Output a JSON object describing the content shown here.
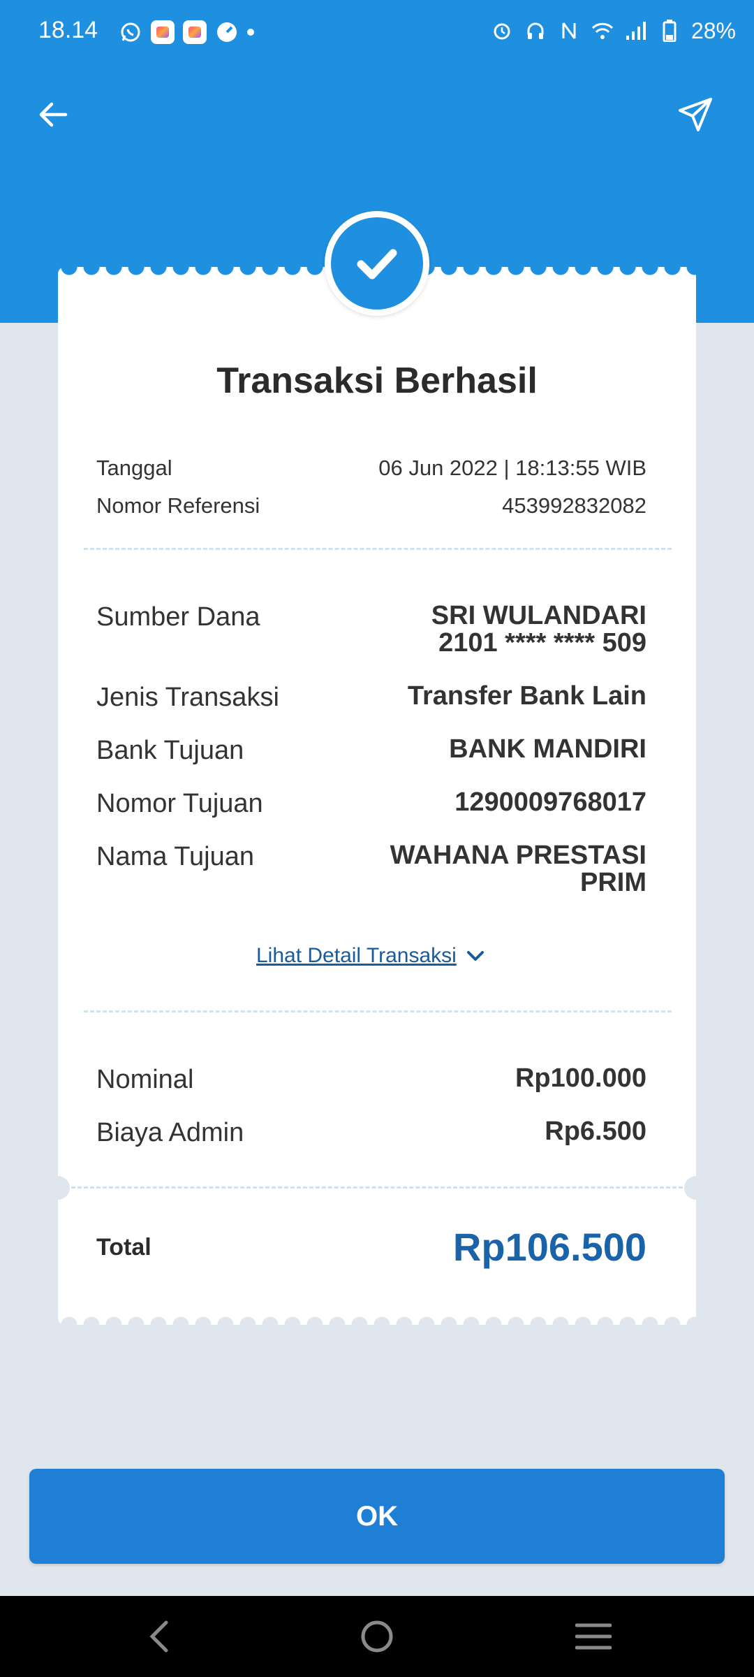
{
  "status_bar": {
    "time": "18.14",
    "battery": "28%"
  },
  "receipt": {
    "title": "Transaksi Berhasil",
    "date_label": "Tanggal",
    "date_value": "06 Jun 2022 | 18:13:55 WIB",
    "ref_label": "Nomor Referensi",
    "ref_value": "453992832082",
    "details": [
      {
        "label": "Sumber Dana",
        "value_line1": "SRI WULANDARI",
        "value_line2": "2101 **** **** 509"
      },
      {
        "label": "Jenis Transaksi",
        "value_line1": "Transfer Bank Lain"
      },
      {
        "label": "Bank Tujuan",
        "value_line1": "BANK MANDIRI"
      },
      {
        "label": "Nomor Tujuan",
        "value_line1": "1290009768017"
      },
      {
        "label": "Nama Tujuan",
        "value_line1": "WAHANA PRESTASI",
        "value_line2": "PRIM"
      }
    ],
    "detail_link": "Lihat Detail Transaksi",
    "nominal_label": "Nominal",
    "nominal_value": "Rp100.000",
    "admin_label": "Biaya Admin",
    "admin_value": "Rp6.500",
    "total_label": "Total",
    "total_value": "Rp106.500"
  },
  "ok_button": "OK",
  "colors": {
    "header": "#1f8fe0",
    "background": "#dfe6ee",
    "accent_text": "#1a63a8",
    "button": "#1f7fd4"
  }
}
